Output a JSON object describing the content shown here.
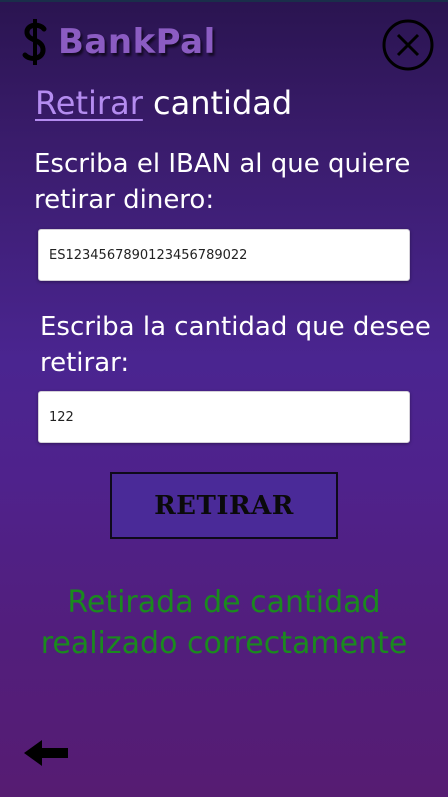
{
  "header": {
    "app_name": "BankPal",
    "logo_icon": "dollar-sign-icon",
    "close_icon": "close-circle-icon"
  },
  "page": {
    "title_accent": "Retirar",
    "title_rest": "cantidad"
  },
  "form": {
    "iban_label": "Escriba el IBAN al que quiere retirar dinero:",
    "iban_value": "ES1234567890123456789022",
    "amount_label": "Escriba la cantidad que desee retirar:",
    "amount_value": "122",
    "submit_label": "RETIRAR"
  },
  "status": {
    "message": "Retirada de cantidad realizado correctamente"
  },
  "footer": {
    "back_icon": "arrow-left-icon"
  },
  "colors": {
    "accent": "#b48cf0",
    "logo": "#8b5cc2",
    "success": "#1a8a1e",
    "button_bg": "#4a2a98"
  }
}
